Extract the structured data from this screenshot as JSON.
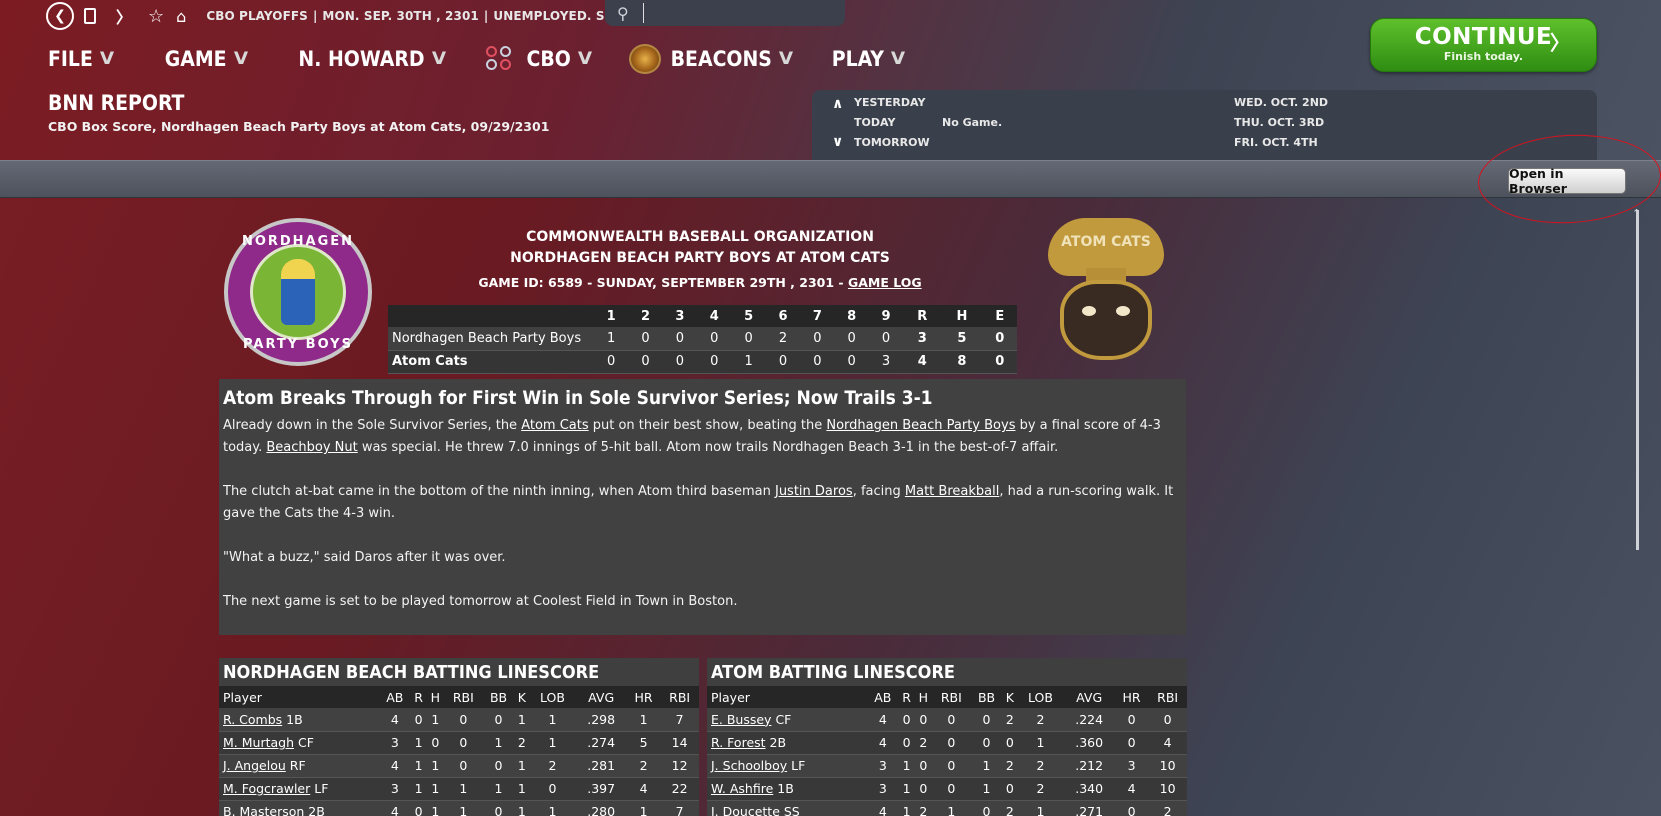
{
  "topbar": {
    "crumb1": "CBO PLAYOFFS",
    "crumb2": "MON. SEP. 30TH , 2301",
    "crumb3": "UNEMPLOYED. SEARCH JOBS...",
    "search_placeholder": ""
  },
  "menu": {
    "file": "FILE",
    "game": "GAME",
    "manager": "N. HOWARD",
    "league": "CBO",
    "beacons": "BEACONS",
    "play": "PLAY"
  },
  "continue": {
    "label": "CONTINUE",
    "sub": "Finish today."
  },
  "page": {
    "title": "BNN REPORT",
    "subtitle": "CBO Box Score, Nordhagen Beach Party Boys at Atom Cats, 09/29/2301"
  },
  "schedule": {
    "yesterday": "YESTERDAY",
    "today": "TODAY",
    "today_value": "No Game.",
    "tomorrow": "TOMORROW",
    "d1": "WED. OCT. 2ND",
    "d2": "THU. OCT. 3RD",
    "d3": "FRI. OCT. 4TH"
  },
  "open_browser": "Open in Browser",
  "logos": {
    "home_ring_top": "NORDHAGEN",
    "home_ring_bottom": "PARTY BOYS",
    "away_text": "ATOM CATS"
  },
  "boxscore": {
    "org": "COMMONWEALTH BASEBALL ORGANIZATION",
    "matchup": "NORDHAGEN BEACH PARTY BOYS AT ATOM CATS",
    "gameid": "GAME ID: 6589 - SUNDAY, SEPTEMBER 29TH , 2301 - ",
    "gamelog": "GAME LOG",
    "headers": [
      "1",
      "2",
      "3",
      "4",
      "5",
      "6",
      "7",
      "8",
      "9",
      "R",
      "H",
      "E"
    ],
    "rows": [
      {
        "team": "Nordhagen Beach Party Boys",
        "innings": [
          "1",
          "0",
          "0",
          "0",
          "0",
          "2",
          "0",
          "0",
          "0"
        ],
        "r": "3",
        "h": "5",
        "e": "0"
      },
      {
        "team": "Atom Cats",
        "innings": [
          "0",
          "0",
          "0",
          "0",
          "1",
          "0",
          "0",
          "0",
          "3"
        ],
        "r": "4",
        "h": "8",
        "e": "0"
      }
    ]
  },
  "story": {
    "headline": "Atom Breaks Through for First Win in Sole Survivor Series; Now Trails 3-1",
    "p1a": "Already down in the Sole Survivor Series, the ",
    "p1_link1": "Atom Cats",
    "p1b": " put on their best show, beating the ",
    "p1_link2": "Nordhagen Beach Party Boys",
    "p1c": " by a final score of 4-3 today. ",
    "p1_link3": "Beachboy Nut",
    "p1d": " was special. He threw 7.0 innings of 5-hit ball. Atom now trails Nordhagen Beach 3-1 in the best-of-7 affair.",
    "p2a": "The clutch at-bat came in the bottom of the ninth inning, when Atom third baseman ",
    "p2_link1": "Justin Daros",
    "p2b": ", facing ",
    "p2_link2": "Matt Breakball",
    "p2c": ", had a run-scoring walk. It gave the Cats the 4-3 win.",
    "p3": "\"What a buzz,\" said Daros after it was over.",
    "p4": "The next game is set to be played tomorrow at Coolest Field in Town in Boston."
  },
  "batting_headers": [
    "Player",
    "AB",
    "R",
    "H",
    "RBI",
    "BB",
    "K",
    "LOB",
    "AVG",
    "HR",
    "RBI"
  ],
  "home_batting": {
    "title": "NORDHAGEN BEACH BATTING LINESCORE",
    "rows": [
      {
        "name": "R. Combs",
        "pos": "1B",
        "stats": [
          "4",
          "0",
          "1",
          "0",
          "0",
          "1",
          "1",
          ".298",
          "1",
          "7"
        ]
      },
      {
        "name": "M. Murtagh",
        "pos": "CF",
        "stats": [
          "3",
          "1",
          "0",
          "0",
          "1",
          "2",
          "1",
          ".274",
          "5",
          "14"
        ]
      },
      {
        "name": "J. Angelou",
        "pos": "RF",
        "stats": [
          "4",
          "1",
          "1",
          "0",
          "0",
          "1",
          "2",
          ".281",
          "2",
          "12"
        ]
      },
      {
        "name": "M. Fogcrawler",
        "pos": "LF",
        "stats": [
          "3",
          "1",
          "1",
          "1",
          "1",
          "1",
          "0",
          ".397",
          "4",
          "22"
        ]
      },
      {
        "name": "B. Masterson",
        "pos": "2B",
        "stats": [
          "4",
          "0",
          "1",
          "1",
          "0",
          "1",
          "1",
          ".280",
          "1",
          "7"
        ]
      }
    ]
  },
  "away_batting": {
    "title": "ATOM BATTING LINESCORE",
    "rows": [
      {
        "name": "E. Bussey",
        "pos": "CF",
        "stats": [
          "4",
          "0",
          "0",
          "0",
          "0",
          "2",
          "2",
          ".224",
          "0",
          "0"
        ]
      },
      {
        "name": "R. Forest",
        "pos": "2B",
        "stats": [
          "4",
          "0",
          "2",
          "0",
          "0",
          "0",
          "1",
          ".360",
          "0",
          "4"
        ]
      },
      {
        "name": "J. Schoolboy",
        "pos": "LF",
        "stats": [
          "3",
          "1",
          "0",
          "0",
          "1",
          "2",
          "2",
          ".212",
          "3",
          "10"
        ]
      },
      {
        "name": "W. Ashfire",
        "pos": "1B",
        "stats": [
          "3",
          "1",
          "0",
          "0",
          "1",
          "0",
          "2",
          ".340",
          "4",
          "10"
        ]
      },
      {
        "name": "J. Doucette",
        "pos": "SS",
        "stats": [
          "4",
          "1",
          "2",
          "1",
          "0",
          "2",
          "1",
          ".271",
          "0",
          "2"
        ]
      }
    ]
  }
}
